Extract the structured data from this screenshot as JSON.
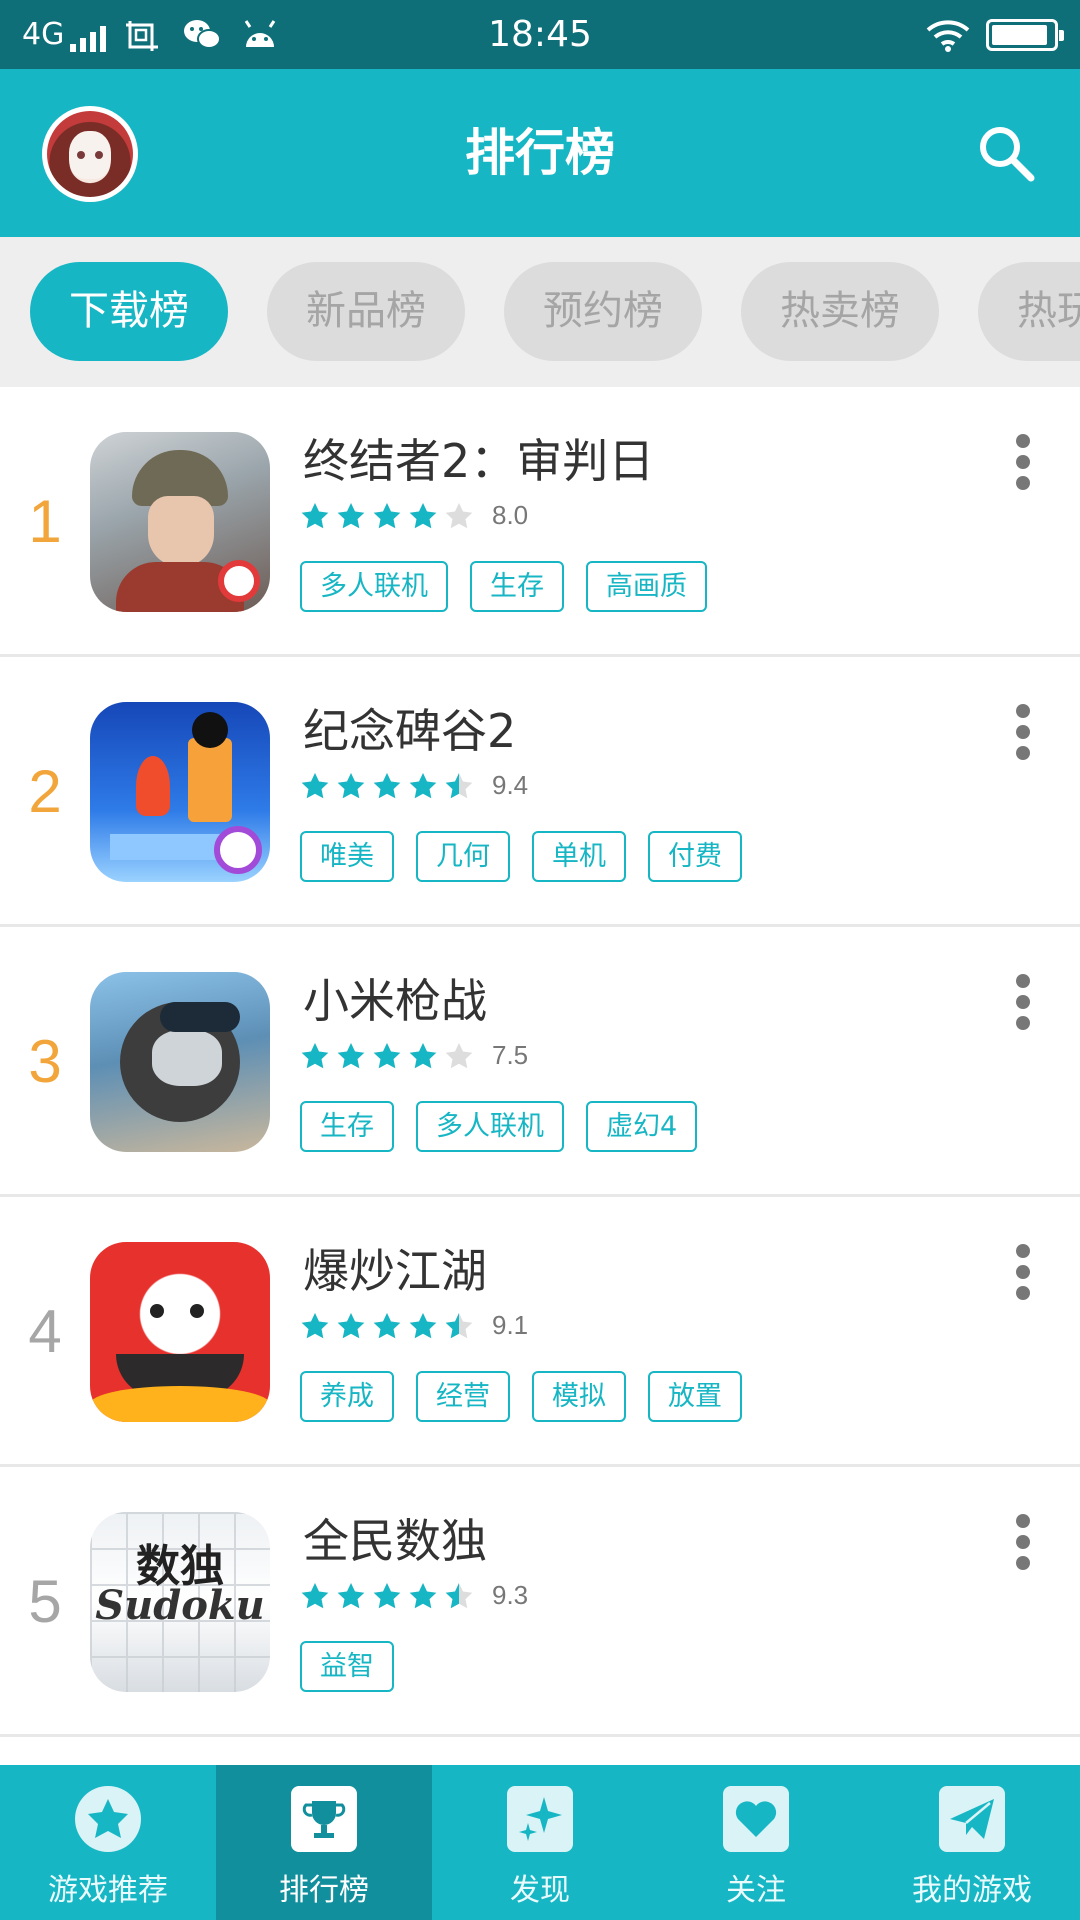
{
  "status_bar": {
    "network": "4G",
    "time": "18:45",
    "battery_level": 0.92
  },
  "header": {
    "title": "排行榜"
  },
  "tabs": [
    {
      "label": "下载榜",
      "active": true
    },
    {
      "label": "新品榜",
      "active": false
    },
    {
      "label": "预约榜",
      "active": false
    },
    {
      "label": "热卖榜",
      "active": false
    },
    {
      "label": "热玩榜",
      "active": false
    }
  ],
  "games": [
    {
      "rank": "1",
      "name": "终结者2：审判日",
      "rating": "8.0",
      "stars": 4,
      "tags": [
        "多人联机",
        "生存",
        "高画质"
      ]
    },
    {
      "rank": "2",
      "name": "纪念碑谷2",
      "rating": "9.4",
      "stars": 4.5,
      "tags": [
        "唯美",
        "几何",
        "单机",
        "付费"
      ]
    },
    {
      "rank": "3",
      "name": "小米枪战",
      "rating": "7.5",
      "stars": 4,
      "tags": [
        "生存",
        "多人联机",
        "虚幻4"
      ]
    },
    {
      "rank": "4",
      "name": "爆炒江湖",
      "rating": "9.1",
      "stars": 4.5,
      "tags": [
        "养成",
        "经营",
        "模拟",
        "放置"
      ]
    },
    {
      "rank": "5",
      "name": "全民数独",
      "rating": "9.3",
      "stars": 4.5,
      "tags": [
        "益智"
      ],
      "icon_text": {
        "cn": "数独",
        "en": "Sudoku"
      }
    }
  ],
  "bottom_nav": [
    {
      "label": "游戏推荐",
      "icon": "star-icon",
      "active": false
    },
    {
      "label": "排行榜",
      "icon": "trophy-icon",
      "active": true
    },
    {
      "label": "发现",
      "icon": "sparkle-icon",
      "active": false
    },
    {
      "label": "关注",
      "icon": "heart-icon",
      "active": false
    },
    {
      "label": "我的游戏",
      "icon": "paper-plane-icon",
      "active": false
    }
  ],
  "colors": {
    "accent": "#17b6c4",
    "status_bar": "#0f6f78",
    "rank_top": "#f2a53a",
    "rank_plain": "#a6a6a6",
    "star_empty": "#dddddd"
  }
}
